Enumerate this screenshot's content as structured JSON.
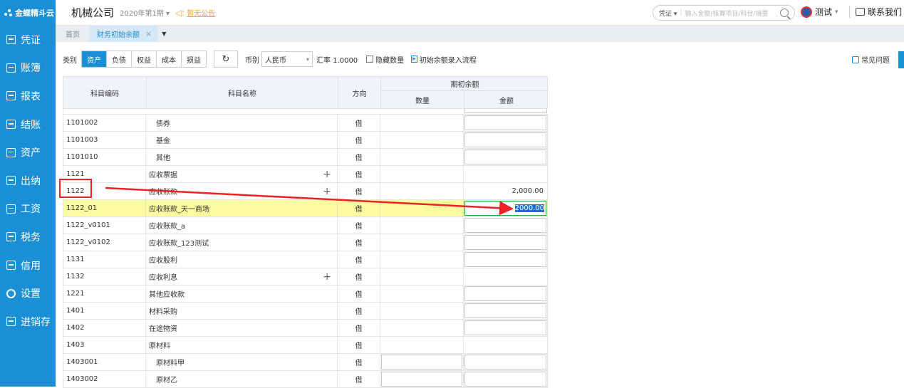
{
  "sidebar": {
    "logo": "金蝶精斗云",
    "items": [
      {
        "label": "凭证",
        "icon": "voucher-icon"
      },
      {
        "label": "账簿",
        "icon": "ledger-icon"
      },
      {
        "label": "报表",
        "icon": "report-icon"
      },
      {
        "label": "结账",
        "icon": "checkout-icon"
      },
      {
        "label": "资产",
        "icon": "asset-icon"
      },
      {
        "label": "出纳",
        "icon": "cashier-icon"
      },
      {
        "label": "工资",
        "icon": "payroll-icon"
      },
      {
        "label": "税务",
        "icon": "tax-icon"
      },
      {
        "label": "信用",
        "icon": "credit-icon"
      },
      {
        "label": "设置",
        "icon": "gear-icon"
      },
      {
        "label": "进销存",
        "icon": "inventory-icon"
      }
    ],
    "colors": {
      "bg": "#1a8fd6"
    }
  },
  "header": {
    "company": "机械公司",
    "period": "2020年第1期 ▾",
    "notice": "暂无公告",
    "search_type": "凭证 ▾",
    "search_placeholder": "输入金额/核算项目/科目/摘要",
    "user": "测试",
    "user_arrow": "▾",
    "contact": "联系我们"
  },
  "tabs": {
    "home": "首页",
    "active": "财务初始余额",
    "close": "×",
    "dropdown": "▼"
  },
  "toolbar": {
    "category_label": "类别",
    "categories": [
      "资产",
      "负债",
      "权益",
      "成本",
      "损益"
    ],
    "active_category": "资产",
    "refresh": "↻",
    "currency_label": "币别",
    "currency": "人民币",
    "rate_label": "汇率 1.0000",
    "hide_qty": "隐藏数量",
    "flow_link": "初始余额录入流程",
    "faq": "常见问题"
  },
  "table": {
    "headers": {
      "code": "科目编码",
      "name": "科目名称",
      "direction": "方向",
      "opening": "期初余额",
      "qty": "数量",
      "amount": "金额"
    },
    "rows": [
      {
        "code": "1101002",
        "name": "债券",
        "indent": true,
        "dir": "借",
        "qty": "",
        "amt": "",
        "qty_input": false,
        "amt_input": true,
        "plus": false
      },
      {
        "code": "1101003",
        "name": "基金",
        "indent": true,
        "dir": "借",
        "qty": "",
        "amt": "",
        "qty_input": false,
        "amt_input": true,
        "plus": false
      },
      {
        "code": "1101010",
        "name": "其他",
        "indent": true,
        "dir": "借",
        "qty": "",
        "amt": "",
        "qty_input": false,
        "amt_input": true,
        "plus": false
      },
      {
        "code": "1121",
        "name": "应收票据",
        "indent": false,
        "dir": "借",
        "qty": "",
        "amt": "",
        "qty_input": false,
        "amt_input": false,
        "plus": true
      },
      {
        "code": "1122",
        "name": "应收账款",
        "indent": false,
        "dir": "借",
        "qty": "",
        "amt": "2,000.00",
        "qty_input": false,
        "amt_input": false,
        "plus": true
      },
      {
        "code": "1122_01",
        "name": "应收账款_天一商场",
        "indent": false,
        "dir": "借",
        "qty": "",
        "amt": "2000.00",
        "qty_input": false,
        "amt_input": true,
        "active": true,
        "plus": false
      },
      {
        "code": "1122_v0101",
        "name": "应收账款_a",
        "indent": false,
        "dir": "借",
        "qty": "",
        "amt": "",
        "qty_input": false,
        "amt_input": true,
        "plus": false
      },
      {
        "code": "1122_v0102",
        "name": "应收账款_123测试",
        "indent": false,
        "dir": "借",
        "qty": "",
        "amt": "",
        "qty_input": false,
        "amt_input": true,
        "plus": false
      },
      {
        "code": "1131",
        "name": "应收股利",
        "indent": false,
        "dir": "借",
        "qty": "",
        "amt": "",
        "qty_input": false,
        "amt_input": true,
        "plus": false
      },
      {
        "code": "1132",
        "name": "应收利息",
        "indent": false,
        "dir": "借",
        "qty": "",
        "amt": "",
        "qty_input": false,
        "amt_input": false,
        "plus": true
      },
      {
        "code": "1221",
        "name": "其他应收款",
        "indent": false,
        "dir": "借",
        "qty": "",
        "amt": "",
        "qty_input": false,
        "amt_input": true,
        "plus": false
      },
      {
        "code": "1401",
        "name": "材料采购",
        "indent": false,
        "dir": "借",
        "qty": "",
        "amt": "",
        "qty_input": false,
        "amt_input": true,
        "plus": false
      },
      {
        "code": "1402",
        "name": "在途物资",
        "indent": false,
        "dir": "借",
        "qty": "",
        "amt": "",
        "qty_input": false,
        "amt_input": true,
        "plus": false
      },
      {
        "code": "1403",
        "name": "原材料",
        "indent": false,
        "dir": "借",
        "qty": "",
        "amt": "",
        "qty_input": false,
        "amt_input": false,
        "plus": false
      },
      {
        "code": "1403001",
        "name": "原材料甲",
        "indent": true,
        "dir": "借",
        "qty": "",
        "amt": "",
        "qty_input": true,
        "amt_input": true,
        "plus": false
      },
      {
        "code": "1403002",
        "name": "原材乙",
        "indent": true,
        "dir": "借",
        "qty": "",
        "amt": "",
        "qty_input": true,
        "amt_input": true,
        "plus": false
      }
    ]
  },
  "annotation": {
    "color": "#e22222"
  }
}
